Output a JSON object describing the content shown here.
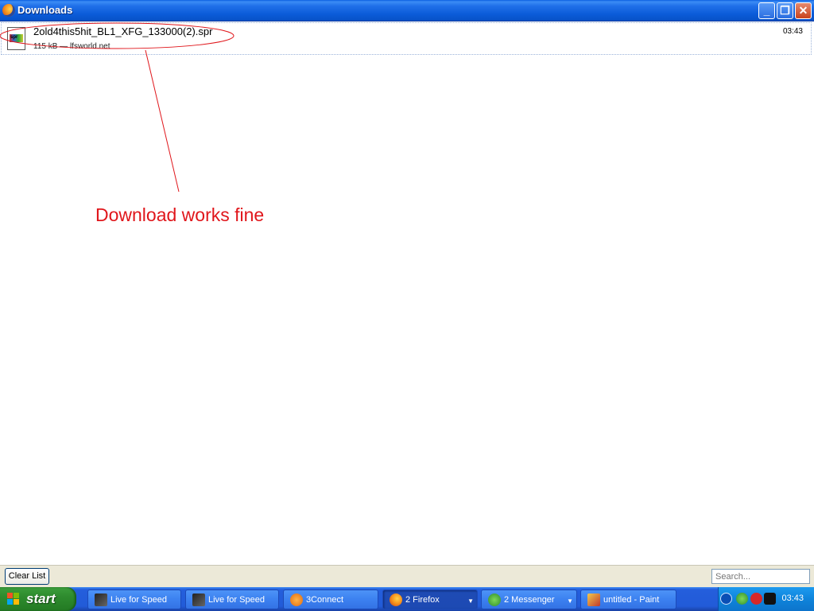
{
  "window": {
    "title": "Downloads",
    "minimize": "_",
    "maximize": "❐",
    "close": "✕"
  },
  "download": {
    "file_name": "2old4this5hit_BL1_XFG_133000(2).spr",
    "meta": "115 kB — lfsworld.net",
    "time": "03:43",
    "icon_text": "spr"
  },
  "annotation": {
    "text": "Download works fine",
    "color": "#e0161b"
  },
  "bottom_bar": {
    "clear_list": "Clear List",
    "search_placeholder": "Search..."
  },
  "taskbar": {
    "start_label": "start",
    "tasks": [
      {
        "label": "Live for Speed",
        "icon": "lfs-icon"
      },
      {
        "label": "Live for Speed",
        "icon": "lfs-icon"
      },
      {
        "label": "3Connect",
        "icon": "3connect-icon"
      },
      {
        "label": "2 Firefox",
        "icon": "firefox-icon",
        "active": true
      },
      {
        "label": "2 Messenger",
        "icon": "messenger-icon"
      },
      {
        "label": "untitled - Paint",
        "icon": "paint-icon"
      }
    ],
    "clock": "03:43"
  }
}
